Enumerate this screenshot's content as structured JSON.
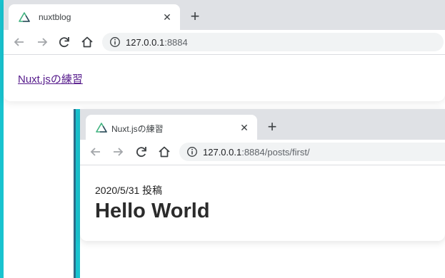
{
  "colors": {
    "accent": "#19c3cf",
    "tabstrip": "#dfe1e5",
    "link_visited": "#551a8b"
  },
  "window1": {
    "tab": {
      "favicon": "nuxt-logo-icon",
      "title": "nuxtblog",
      "close": "✕"
    },
    "new_tab": "+",
    "address": {
      "host": "127.0.0.1",
      "port": ":8884"
    },
    "page": {
      "link_text": "Nuxt.jsの練習"
    }
  },
  "window2": {
    "tab": {
      "favicon": "nuxt-logo-icon",
      "title": "Nuxt.jsの練習",
      "close": "✕"
    },
    "new_tab": "+",
    "address": {
      "host": "127.0.0.1",
      "port": ":8884/posts/first/"
    },
    "page": {
      "post_meta": "2020/5/31 投稿",
      "post_title": "Hello World"
    }
  }
}
